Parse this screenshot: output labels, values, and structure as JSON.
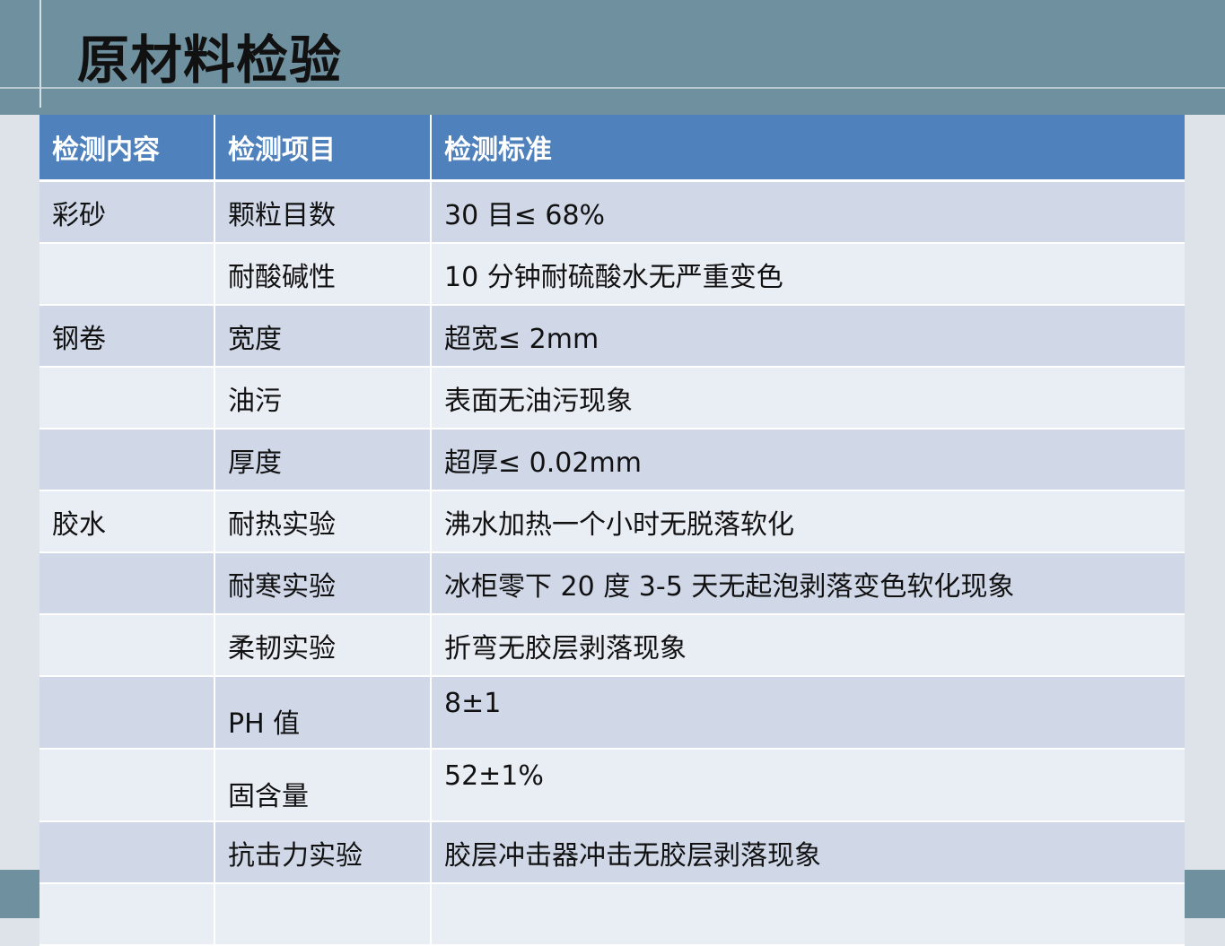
{
  "page": {
    "title": "原材料检验"
  },
  "table": {
    "headers": [
      "检测内容",
      "检测项目",
      "检测标准"
    ],
    "rows": [
      {
        "content": "彩砂",
        "item": "颗粒目数",
        "standard": "30 目≤ 68%"
      },
      {
        "content": "",
        "item": "耐酸碱性",
        "standard": "10 分钟耐硫酸水无严重变色"
      },
      {
        "content": "钢卷",
        "item": "宽度",
        "standard": "超宽≤ 2mm"
      },
      {
        "content": "",
        "item": "油污",
        "standard": "表面无油污现象"
      },
      {
        "content": "",
        "item": "厚度",
        "standard": "超厚≤ 0.02mm"
      },
      {
        "content": "胶水",
        "item": "耐热实验",
        "standard": "沸水加热一个小时无脱落软化"
      },
      {
        "content": "",
        "item": "耐寒实验",
        "standard": "冰柜零下 20 度 3-5 天无起泡剥落变色软化现象"
      },
      {
        "content": "",
        "item": "柔韧实验",
        "standard": "折弯无胶层剥落现象"
      },
      {
        "content": "",
        "item": "PH 值",
        "standard": "8±1"
      },
      {
        "content": "",
        "item": "固含量",
        "standard": "52±1%"
      },
      {
        "content": "",
        "item": "抗击力实验",
        "standard": "胶层冲击器冲击无胶层剥落现象"
      },
      {
        "content": "",
        "item": "",
        "standard": ""
      }
    ]
  },
  "colors": {
    "header_bg": "#4f81bd",
    "row_odd": "#d0d8e8",
    "row_even": "#e9edf4",
    "band": "#6e909f"
  }
}
